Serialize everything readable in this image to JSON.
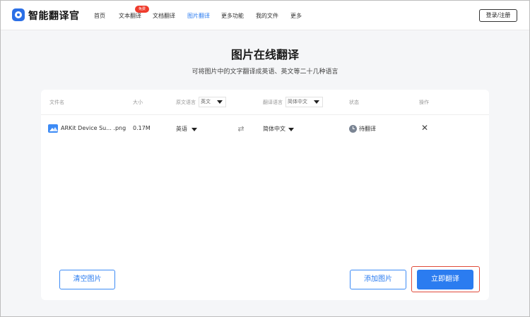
{
  "header": {
    "brand": "智能翻译官",
    "nav": [
      {
        "label": "首页"
      },
      {
        "label": "文本翻译",
        "badge": "免费"
      },
      {
        "label": "文档翻译"
      },
      {
        "label": "图片翻译"
      },
      {
        "label": "更多功能"
      },
      {
        "label": "我的文件"
      },
      {
        "label": "更多"
      }
    ],
    "active_nav": "图片翻译",
    "login_label": "登录/注册"
  },
  "hero": {
    "title": "图片在线翻译",
    "subtitle": "可将图片中的文字翻译成英语、英文等二十几种语言"
  },
  "table": {
    "headers": {
      "filename": "文件名",
      "size": "大小",
      "source_lang": "原文语言",
      "source_lang_value": "英文",
      "target_lang": "翻译语言",
      "target_lang_value": "简体中文",
      "status": "状态",
      "action": "操作"
    },
    "rows": [
      {
        "filename": "ARKit Device Su... .png",
        "size": "0.17M",
        "source_lang": "英语",
        "target_lang": "简体中文",
        "status": "待翻译"
      }
    ]
  },
  "buttons": {
    "clear": "清空图片",
    "add": "添加图片",
    "translate": "立即翻译"
  },
  "colors": {
    "accent": "#2b7cf0",
    "badge": "#ef3b2c",
    "highlight": "#e04a3a",
    "background": "#f5f6f8"
  },
  "icons": [
    "logo-icon",
    "image-file-icon",
    "swap-icon",
    "clock-icon",
    "close-icon",
    "chevron-down-icon"
  ]
}
